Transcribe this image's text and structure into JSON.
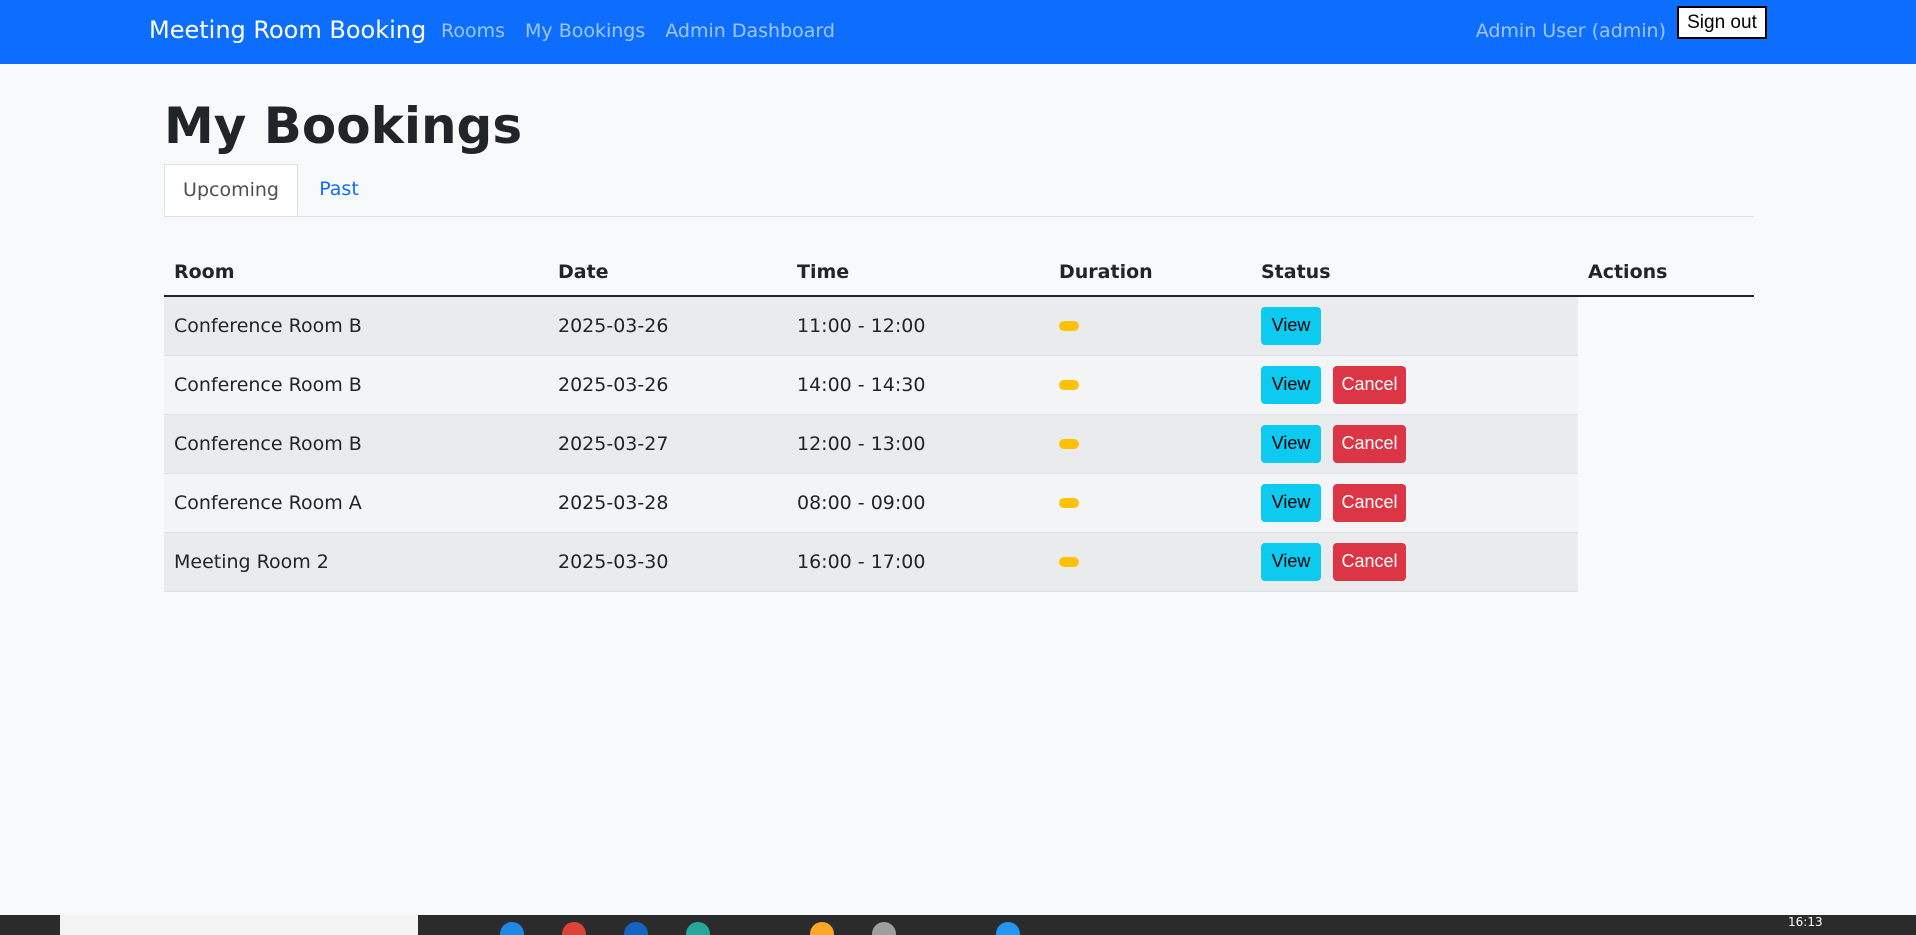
{
  "navbar": {
    "brand": "Meeting Room Booking",
    "links": [
      "Rooms",
      "My Bookings",
      "Admin Dashboard"
    ],
    "user": "Admin User (admin)",
    "signout_label": "Sign out"
  },
  "page": {
    "title": "My Bookings"
  },
  "tabs": [
    {
      "label": "Upcoming",
      "active": true
    },
    {
      "label": "Past",
      "active": false
    }
  ],
  "table": {
    "columns": [
      "Room",
      "Date",
      "Time",
      "Duration",
      "Status",
      "Actions"
    ],
    "rows": [
      {
        "room": "Conference Room B",
        "date": "2025-03-26",
        "time": "11:00 - 12:00",
        "view": "View",
        "cancel": ""
      },
      {
        "room": "Conference Room B",
        "date": "2025-03-26",
        "time": "14:00 - 14:30",
        "view": "View",
        "cancel": "Cancel"
      },
      {
        "room": "Conference Room B",
        "date": "2025-03-27",
        "time": "12:00 - 13:00",
        "view": "View",
        "cancel": "Cancel"
      },
      {
        "room": "Conference Room A",
        "date": "2025-03-28",
        "time": "08:00 - 09:00",
        "view": "View",
        "cancel": "Cancel"
      },
      {
        "room": "Meeting Room 2",
        "date": "2025-03-30",
        "time": "16:00 - 17:00",
        "view": "View",
        "cancel": "Cancel"
      }
    ]
  },
  "colors": {
    "navbar": "#0d6efd",
    "status_badge": "#ffc107",
    "view_button": "#0dcaf0",
    "cancel_button": "#dc3545"
  },
  "taskbar": {
    "clock": "16:13"
  }
}
